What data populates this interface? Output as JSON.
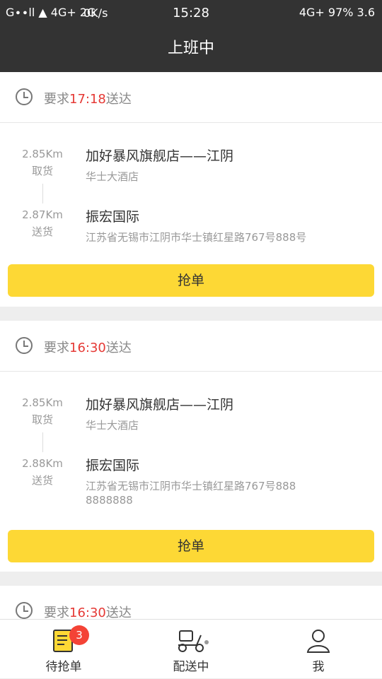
{
  "status_bar": {
    "left_indicators": "G∙∙ll ▲ 4G+ 2G",
    "net_speed": "0K/s",
    "time": "15:28",
    "right_indicators": "4G+ 97% 3.6"
  },
  "header": {
    "title": "上班中"
  },
  "orders": [
    {
      "deadline_prefix": "要求",
      "deadline_time": "17:18",
      "deadline_suffix": "送达",
      "pickup": {
        "distance": "2.85Km",
        "type_label": "取货",
        "name": "加好暴风旗舰店——江阴",
        "address": "华士大酒店"
      },
      "dropoff": {
        "distance": "2.87Km",
        "type_label": "送货",
        "name": "振宏国际",
        "address": "江苏省无锡市江阴市华士镇红星路767号888号"
      },
      "button_label": "抢单"
    },
    {
      "deadline_prefix": "要求",
      "deadline_time": "16:30",
      "deadline_suffix": "送达",
      "pickup": {
        "distance": "2.85Km",
        "type_label": "取货",
        "name": "加好暴风旗舰店——江阴",
        "address": "华士大酒店"
      },
      "dropoff": {
        "distance": "2.88Km",
        "type_label": "送货",
        "name": "振宏国际",
        "address": "江苏省无锡市江阴市华士镇红星路767号8888888888"
      },
      "button_label": "抢单"
    },
    {
      "deadline_prefix": "要求",
      "deadline_time": "16:30",
      "deadline_suffix": "送达"
    }
  ],
  "tabbar": {
    "tabs": [
      {
        "label": "待抢单",
        "icon": "order-list-icon",
        "badge": "3"
      },
      {
        "label": "配送中",
        "icon": "scooter-icon"
      },
      {
        "label": "我",
        "icon": "person-icon"
      }
    ]
  },
  "colors": {
    "header_bg": "#333333",
    "accent_button": "#fdd835",
    "deadline_time": "#e53935",
    "badge": "#f44336"
  }
}
